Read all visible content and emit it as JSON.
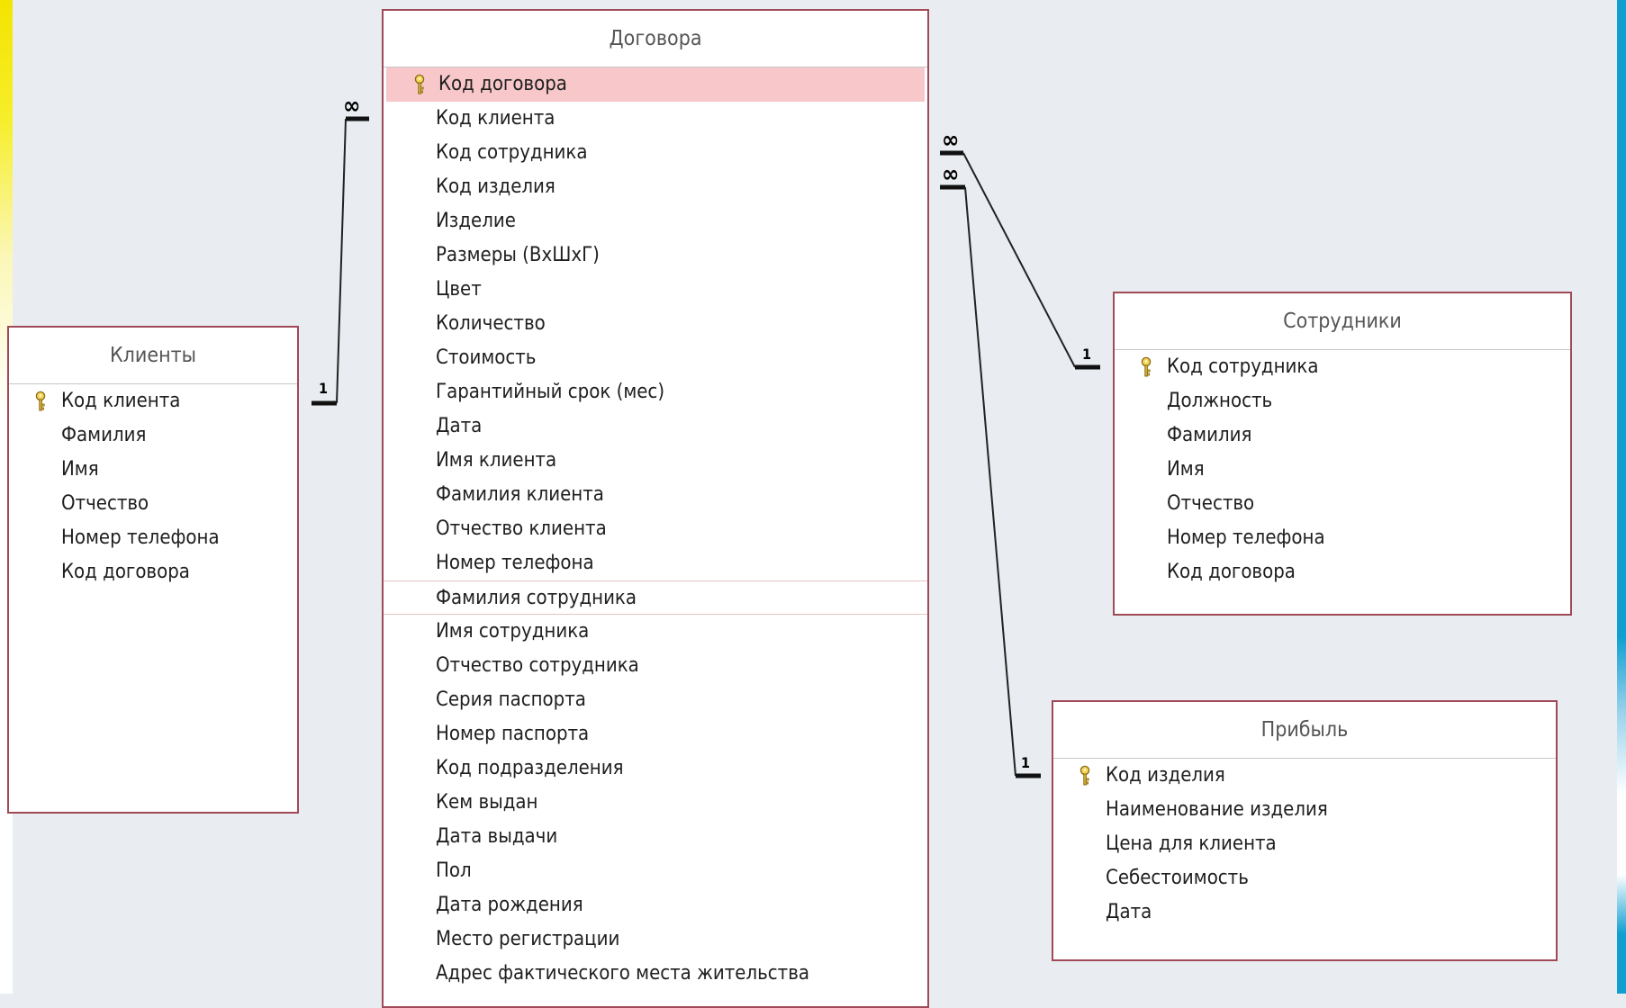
{
  "diagram": {
    "tables": [
      {
        "id": "dogovora",
        "title": "Договора",
        "fields": [
          {
            "label": "Код договора",
            "primary_key": true,
            "selected": true
          },
          {
            "label": "Код клиента"
          },
          {
            "label": "Код сотрудника"
          },
          {
            "label": "Код изделия"
          },
          {
            "label": "Изделие"
          },
          {
            "label": "Размеры (ВхШхГ)"
          },
          {
            "label": "Цвет"
          },
          {
            "label": "Количество"
          },
          {
            "label": "Стоимость"
          },
          {
            "label": "Гарантийный срок (мес)"
          },
          {
            "label": "Дата"
          },
          {
            "label": "Имя клиента"
          },
          {
            "label": "Фамилия клиента"
          },
          {
            "label": "Отчество клиента"
          },
          {
            "label": "Номер телефона"
          },
          {
            "label": "Фамилия сотрудника",
            "outlined": true
          },
          {
            "label": "Имя сотрудника"
          },
          {
            "label": "Отчество сотрудника"
          },
          {
            "label": "Серия паспорта"
          },
          {
            "label": "Номер паспорта"
          },
          {
            "label": "Код подразделения"
          },
          {
            "label": "Кем выдан"
          },
          {
            "label": "Дата выдачи"
          },
          {
            "label": "Пол"
          },
          {
            "label": "Дата рождения"
          },
          {
            "label": "Место регистрации"
          },
          {
            "label": "Адрес фактического места жительства"
          }
        ]
      },
      {
        "id": "klienty",
        "title": "Клиенты",
        "fields": [
          {
            "label": "Код клиента",
            "primary_key": true
          },
          {
            "label": "Фамилия"
          },
          {
            "label": "Имя"
          },
          {
            "label": "Отчество"
          },
          {
            "label": "Номер телефона"
          },
          {
            "label": "Код договора"
          }
        ]
      },
      {
        "id": "sotrudniki",
        "title": "Сотрудники",
        "fields": [
          {
            "label": "Код сотрудника",
            "primary_key": true
          },
          {
            "label": "Должность"
          },
          {
            "label": "Фамилия"
          },
          {
            "label": "Имя"
          },
          {
            "label": "Отчество"
          },
          {
            "label": "Номер телефона"
          },
          {
            "label": "Код договора"
          }
        ]
      },
      {
        "id": "pribyl",
        "title": "Прибыль",
        "fields": [
          {
            "label": "Код изделия",
            "primary_key": true
          },
          {
            "label": "Наименование изделия"
          },
          {
            "label": "Цена для клиента"
          },
          {
            "label": "Себестоимость"
          },
          {
            "label": "Дата"
          }
        ]
      }
    ],
    "relationships": [
      {
        "from_table": "Клиенты",
        "to_table": "Договора",
        "one_label": "1",
        "many_label": "∞"
      },
      {
        "from_table": "Сотрудники",
        "to_table": "Договора",
        "one_label": "1",
        "many_label": "∞"
      },
      {
        "from_table": "Прибыль",
        "to_table": "Договора",
        "one_label": "1",
        "many_label": "∞"
      }
    ],
    "colors": {
      "table_border": "#a04a58",
      "selected_row": "#f7c7c9",
      "background": "#e9edf1",
      "relation_line": "#1a1a1a",
      "key_icon": "#c9a227"
    },
    "icons": {
      "primary_key": "key-icon"
    }
  }
}
